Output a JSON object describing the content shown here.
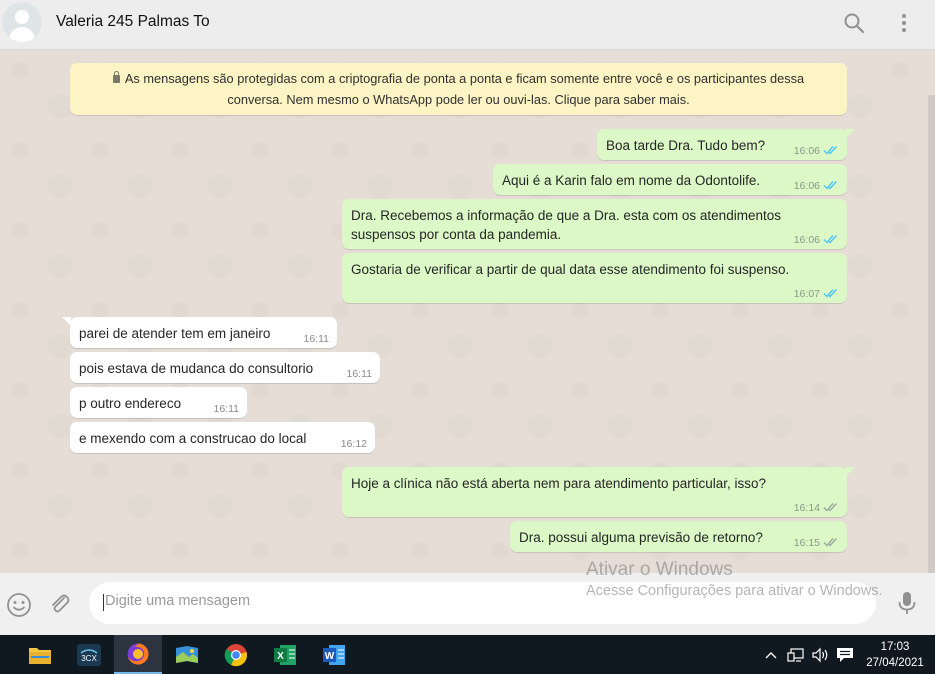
{
  "header": {
    "contact_name": "Valeria 245 Palmas To",
    "icons": [
      "avatar",
      "search-icon",
      "menu-icon"
    ]
  },
  "notice": {
    "line1": "As mensagens são protegidas com a criptografia de ponta a ponta e ficam somente entre você e os participantes dessa",
    "line2": "conversa. Nem mesmo o WhatsApp pode ler ou ouvi-las. Clique para saber mais."
  },
  "messages": [
    {
      "direction": "out",
      "lines": [
        "Boa tarde Dra. Tudo bem?"
      ],
      "time": "16:06",
      "status": "read"
    },
    {
      "direction": "out",
      "lines": [
        "Aqui é a Karin falo em nome da Odontolife."
      ],
      "time": "16:06",
      "status": "read"
    },
    {
      "direction": "out",
      "lines": [
        "Dra. Recebemos a informação de que a Dra. esta com os atendimentos",
        "suspensos por conta da pandemia."
      ],
      "time": "16:06",
      "status": "read"
    },
    {
      "direction": "out",
      "lines": [
        "Gostaria de verificar a partir de qual data esse atendimento foi suspenso."
      ],
      "time": "16:07",
      "status": "read"
    },
    {
      "direction": "in",
      "lines": [
        "parei de atender tem em janeiro"
      ],
      "time": "16:11"
    },
    {
      "direction": "in",
      "lines": [
        "pois estava de mudanca do consultorio"
      ],
      "time": "16:11"
    },
    {
      "direction": "in",
      "lines": [
        "p outro endereco"
      ],
      "time": "16:11"
    },
    {
      "direction": "in",
      "lines": [
        "e mexendo  com a construcao do local"
      ],
      "time": "16:12"
    },
    {
      "direction": "out",
      "lines": [
        "Hoje a clínica não está aberta nem para atendimento particular, isso?"
      ],
      "time": "16:14",
      "status": "delivered"
    },
    {
      "direction": "out",
      "lines": [
        "Dra. possui alguma previsão de retorno?"
      ],
      "time": "16:15",
      "status": "delivered"
    }
  ],
  "watermark": {
    "title": "Ativar o Windows",
    "subtitle": "Acesse Configurações para ativar o Windows."
  },
  "composer": {
    "placeholder": "Digite uma mensagem",
    "value": ""
  },
  "taskbar": {
    "apps": [
      "file-explorer",
      "3cx",
      "firefox",
      "photos",
      "chrome",
      "excel",
      "word"
    ],
    "active_app": "firefox",
    "time": "17:03",
    "date": "27/04/2021"
  },
  "colors": {
    "outgoing_bubble": "#dcf8c6",
    "incoming_bubble": "#ffffff",
    "read_tick": "#4fc3f7",
    "delivered_tick": "#9aa89a",
    "notice_bg": "#fcf4c4"
  }
}
